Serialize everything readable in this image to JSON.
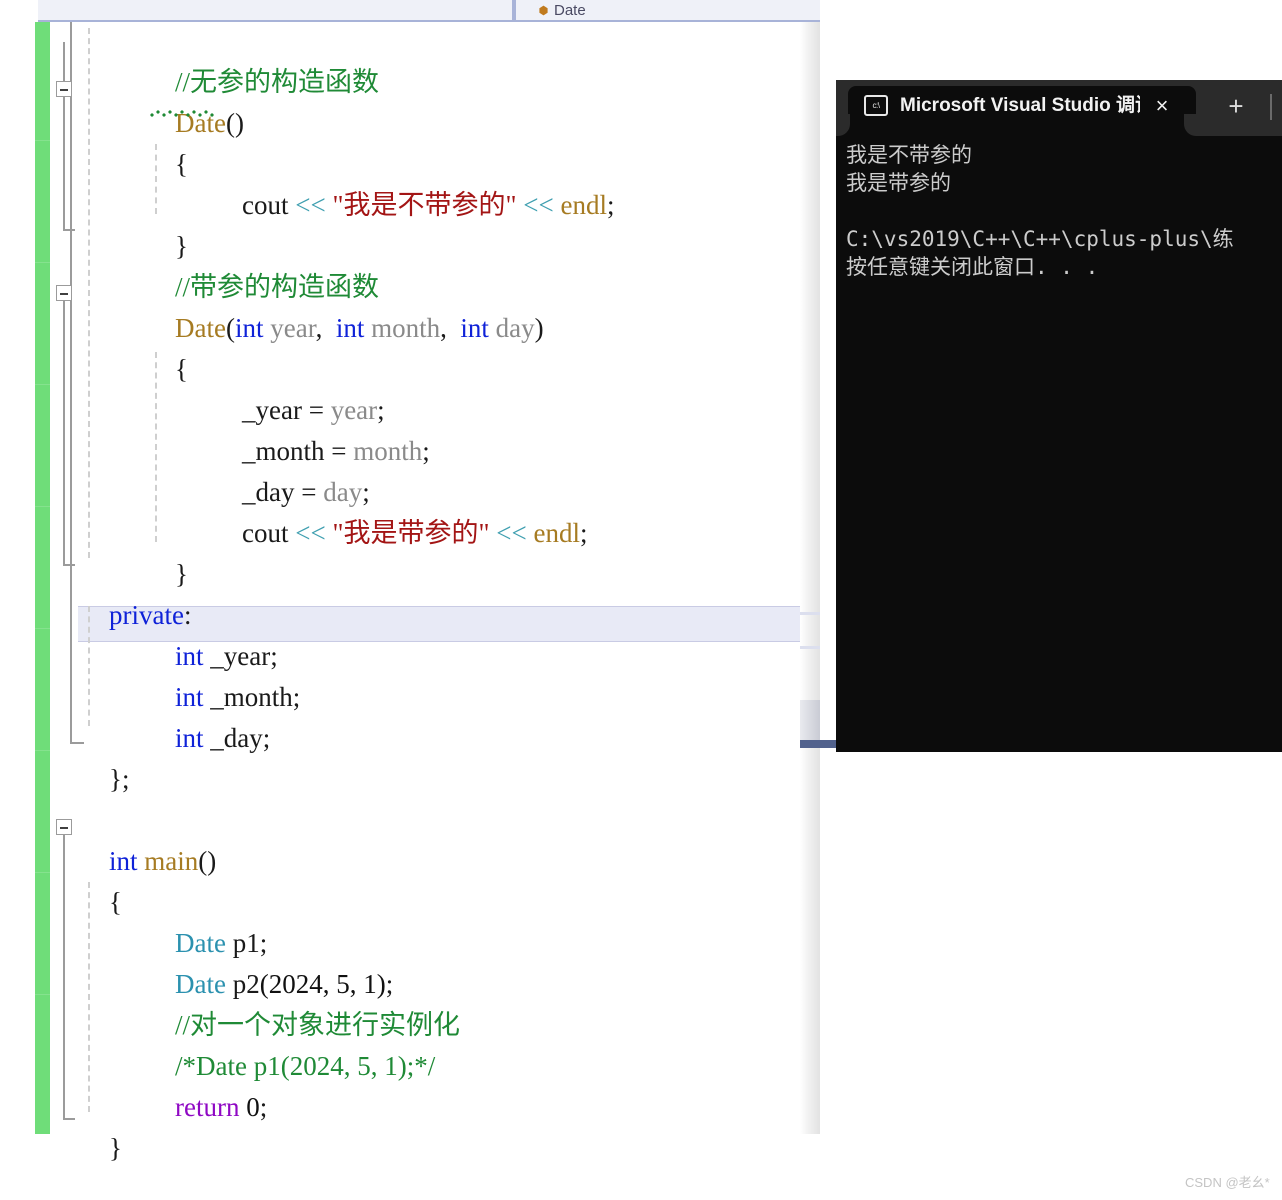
{
  "navbar": {
    "member_label": "Date",
    "member_icon": "purple-diamond-method-icon"
  },
  "editor": {
    "language": "cpp",
    "current_line_text": "    int _year;",
    "colors": {
      "comment": "#1f8a36",
      "keyword": "#0f22d8",
      "control": "#8f08c4",
      "type": "#2b91af",
      "constructor": "#a67b22",
      "identifier": "#8a8a8a",
      "string": "#a31515",
      "operator": "#3f9fb0",
      "change_bar": "#6fdd79",
      "current_line_highlight": "#e8eaf6",
      "squiggle": "#1f8a36"
    },
    "lines": [
      {
        "indent": 1,
        "text": "//无参的构造函数"
      },
      {
        "indent": 1,
        "text": "Date()"
      },
      {
        "indent": 1,
        "text": "{"
      },
      {
        "indent": 2,
        "text": "cout << \"我是不带参的\" << endl;"
      },
      {
        "indent": 1,
        "text": "}"
      },
      {
        "indent": 1,
        "text": "//带参的构造函数"
      },
      {
        "indent": 1,
        "text": "Date(int year, int month, int day)"
      },
      {
        "indent": 1,
        "text": "{"
      },
      {
        "indent": 2,
        "text": "_year = year;"
      },
      {
        "indent": 2,
        "text": "_month = month;"
      },
      {
        "indent": 2,
        "text": "_day = day;"
      },
      {
        "indent": 2,
        "text": "cout << \"我是带参的\" << endl;"
      },
      {
        "indent": 1,
        "text": "}"
      },
      {
        "indent": 0,
        "text": "private:"
      },
      {
        "indent": 1,
        "text": "int _year;"
      },
      {
        "indent": 1,
        "text": "int _month;"
      },
      {
        "indent": 1,
        "text": "int _day;"
      },
      {
        "indent": 0,
        "text": "};"
      },
      {
        "indent": 0,
        "text": ""
      },
      {
        "indent": 0,
        "text": "int main()"
      },
      {
        "indent": 0,
        "text": "{"
      },
      {
        "indent": 1,
        "text": "Date p1;"
      },
      {
        "indent": 1,
        "text": "Date p2(2024, 5, 1);"
      },
      {
        "indent": 1,
        "text": "//对一个对象进行实例化"
      },
      {
        "indent": 1,
        "text": "/*Date p1(2024, 5, 1);*/"
      },
      {
        "indent": 1,
        "text": "return 0;"
      },
      {
        "indent": 0,
        "text": "}"
      }
    ],
    "tokens": {
      "comment_1": "//无参的构造函数",
      "ctor_name": "Date",
      "ctor_parens": "()",
      "brace_open": "{",
      "brace_close": "}",
      "cout": "cout",
      "shift": "<<",
      "string_1": "\"我是不带参的\"",
      "string_2": "\"我是带参的\"",
      "endl": "endl",
      "semicolon": ";",
      "comment_2": "//带参的构造函数",
      "kw_int": "int",
      "param_year": "year",
      "param_month": "month",
      "param_day": "day",
      "comma": ",",
      "assign_year": "_year",
      "assign_month": "_month",
      "assign_day": "_day",
      "eq": "=",
      "kw_private": "private",
      "colon": ":",
      "member_year": "_year",
      "member_month": "_month",
      "member_day": "_day",
      "class_end": "};",
      "main_name": "main",
      "type_date": "Date",
      "var_p1": "p1",
      "var_p2": "p2",
      "args_p2": "(2024, 5, 1)",
      "comment_3": "//对一个对象进行实例化",
      "comment_4": "/*Date p1(2024, 5, 1);*/",
      "kw_return": "return",
      "num_zero": "0"
    }
  },
  "console": {
    "title": "Microsoft Visual Studio 调试控",
    "icon": "cmd-prompt-icon",
    "close_label": "×",
    "newtab_label": "+",
    "output": [
      "我是不带参的",
      "我是带参的",
      "",
      "C:\\vs2019\\C++\\C++\\cplus-plus\\练",
      "按任意键关闭此窗口. . ."
    ]
  },
  "watermark": {
    "text": "CSDN @老幺*"
  }
}
